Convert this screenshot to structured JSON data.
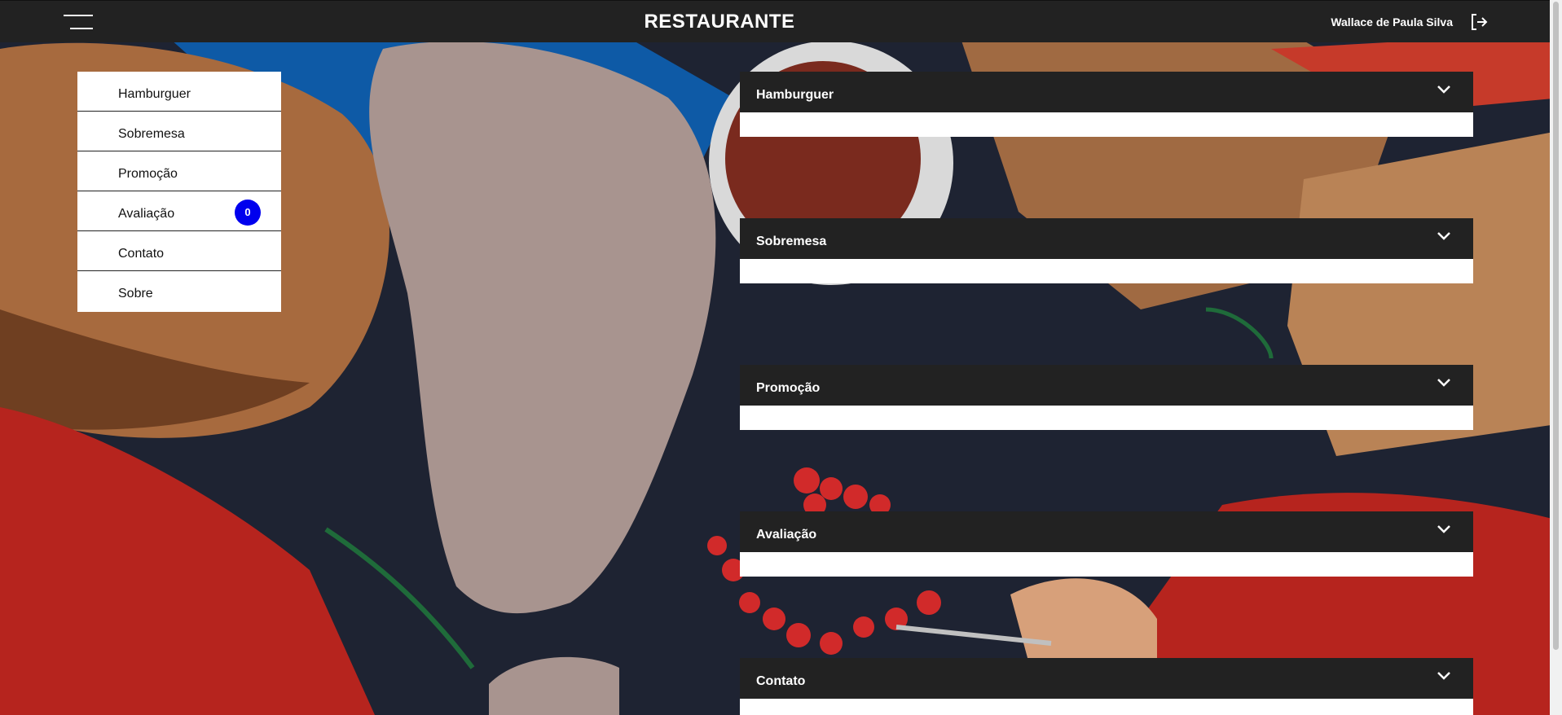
{
  "header": {
    "title": "RESTAURANTE",
    "user_name": "Wallace de Paula Silva",
    "menu_icon": "hamburger-menu-icon",
    "logout_icon": "logout-icon"
  },
  "sidebar": {
    "items": [
      {
        "label": "Hamburguer"
      },
      {
        "label": "Sobremesa"
      },
      {
        "label": "Promoção"
      },
      {
        "label": "Avaliação",
        "badge": "0"
      },
      {
        "label": "Contato"
      },
      {
        "label": "Sobre"
      }
    ]
  },
  "sections": [
    {
      "title": "Hamburguer"
    },
    {
      "title": "Sobremesa"
    },
    {
      "title": "Promoção"
    },
    {
      "title": "Avaliação"
    },
    {
      "title": "Contato"
    }
  ],
  "colors": {
    "header_bg": "#222222",
    "badge_bg": "#0000ee",
    "panel_bg": "#222222"
  }
}
